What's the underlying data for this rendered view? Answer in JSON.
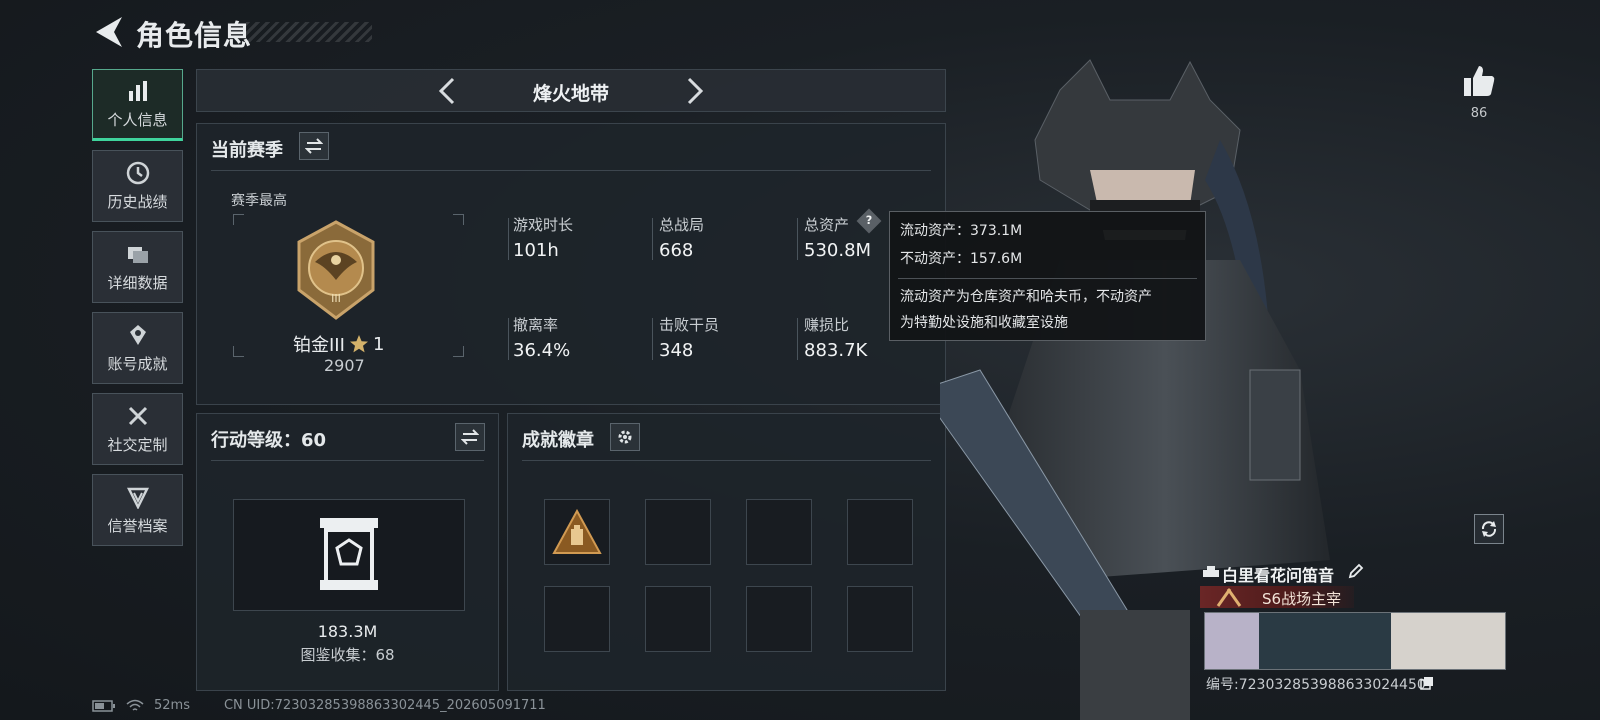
{
  "header": {
    "title": "角色信息"
  },
  "sidebar": {
    "items": [
      {
        "label": "个人信息",
        "icon": "bar-chart-icon",
        "active": true
      },
      {
        "label": "历史战绩",
        "icon": "clock-icon",
        "active": false
      },
      {
        "label": "详细数据",
        "icon": "folder-icon",
        "active": false
      },
      {
        "label": "账号成就",
        "icon": "medal-icon",
        "active": false
      },
      {
        "label": "社交定制",
        "icon": "tools-icon",
        "active": false
      },
      {
        "label": "信誉档案",
        "icon": "shield-icon",
        "active": false
      }
    ]
  },
  "mode": {
    "title": "烽火地带"
  },
  "season": {
    "section_title": "当前赛季",
    "best_label": "赛季最高",
    "rank_name": "铂金III",
    "rank_stars": "1",
    "rank_points": "2907",
    "stats": [
      {
        "label": "游戏时长",
        "value": "101h"
      },
      {
        "label": "总战局",
        "value": "668"
      },
      {
        "label": "总资产",
        "value": "530.8M"
      },
      {
        "label": "撤离率",
        "value": "36.4%"
      },
      {
        "label": "击败干员",
        "value": "348"
      },
      {
        "label": "赚损比",
        "value": "883.7K"
      }
    ]
  },
  "tooltip": {
    "liquid_assets": "流动资产：373.1M",
    "fixed_assets": "不动资产：157.6M",
    "description_line1": "流动资产为仓库资产和哈夫币，不动资产",
    "description_line2": "为特勤处设施和收藏室设施"
  },
  "action_level": {
    "title": "行动等级：60",
    "value": "183.3M",
    "collection": "图鉴收集：68"
  },
  "achievements": {
    "title": "成就徽章",
    "slots": 8,
    "filled": [
      0
    ]
  },
  "profile": {
    "likes": "86",
    "name": "白里看花问笛音",
    "title_badge": "S6战场主宰",
    "player_id": "编号:723032853988633024450"
  },
  "status_bar": {
    "ping": "52ms",
    "uid": "CN UID:72303285398863302445_202605091711"
  },
  "colors": {
    "accent": "#3fd49c",
    "panel": "#1e242a",
    "badge_red": "#6a2626"
  }
}
